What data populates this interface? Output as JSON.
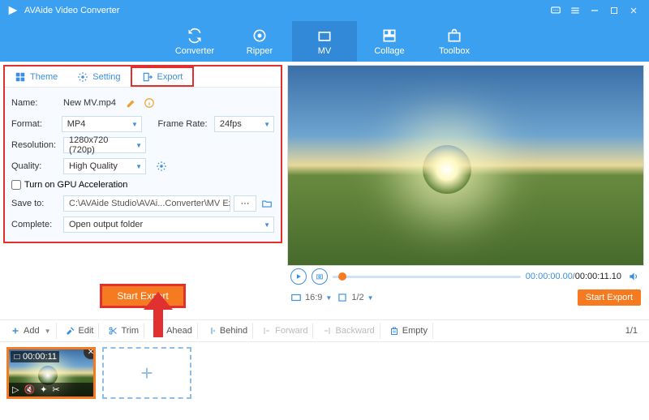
{
  "titlebar": {
    "title": "AVAide Video Converter"
  },
  "nav": {
    "converter": "Converter",
    "ripper": "Ripper",
    "mv": "MV",
    "collage": "Collage",
    "toolbox": "Toolbox"
  },
  "tabs": {
    "theme": "Theme",
    "setting": "Setting",
    "export": "Export"
  },
  "form": {
    "name_label": "Name:",
    "name_value": "New MV.mp4",
    "format_label": "Format:",
    "format_value": "MP4",
    "framerate_label": "Frame Rate:",
    "framerate_value": "24fps",
    "resolution_label": "Resolution:",
    "resolution_value": "1280x720 (720p)",
    "quality_label": "Quality:",
    "quality_value": "High Quality",
    "gpu_label": "Turn on GPU Acceleration",
    "saveto_label": "Save to:",
    "saveto_value": "C:\\AVAide Studio\\AVAi...Converter\\MV Exported",
    "complete_label": "Complete:",
    "complete_value": "Open output folder"
  },
  "start_btn": "Start Export",
  "player": {
    "current": "00:00:00.00",
    "duration": "00:00:11.10"
  },
  "optionbar": {
    "ratio": "16:9",
    "zoom": "1/2",
    "start_export": "Start Export"
  },
  "timeline": {
    "add": "Add",
    "edit": "Edit",
    "trim": "Trim",
    "ahead": "Ahead",
    "behind": "Behind",
    "forward": "Forward",
    "backward": "Backward",
    "empty": "Empty",
    "page": "1/1"
  },
  "clip": {
    "tc": "00:00:11",
    "plus": "+"
  }
}
